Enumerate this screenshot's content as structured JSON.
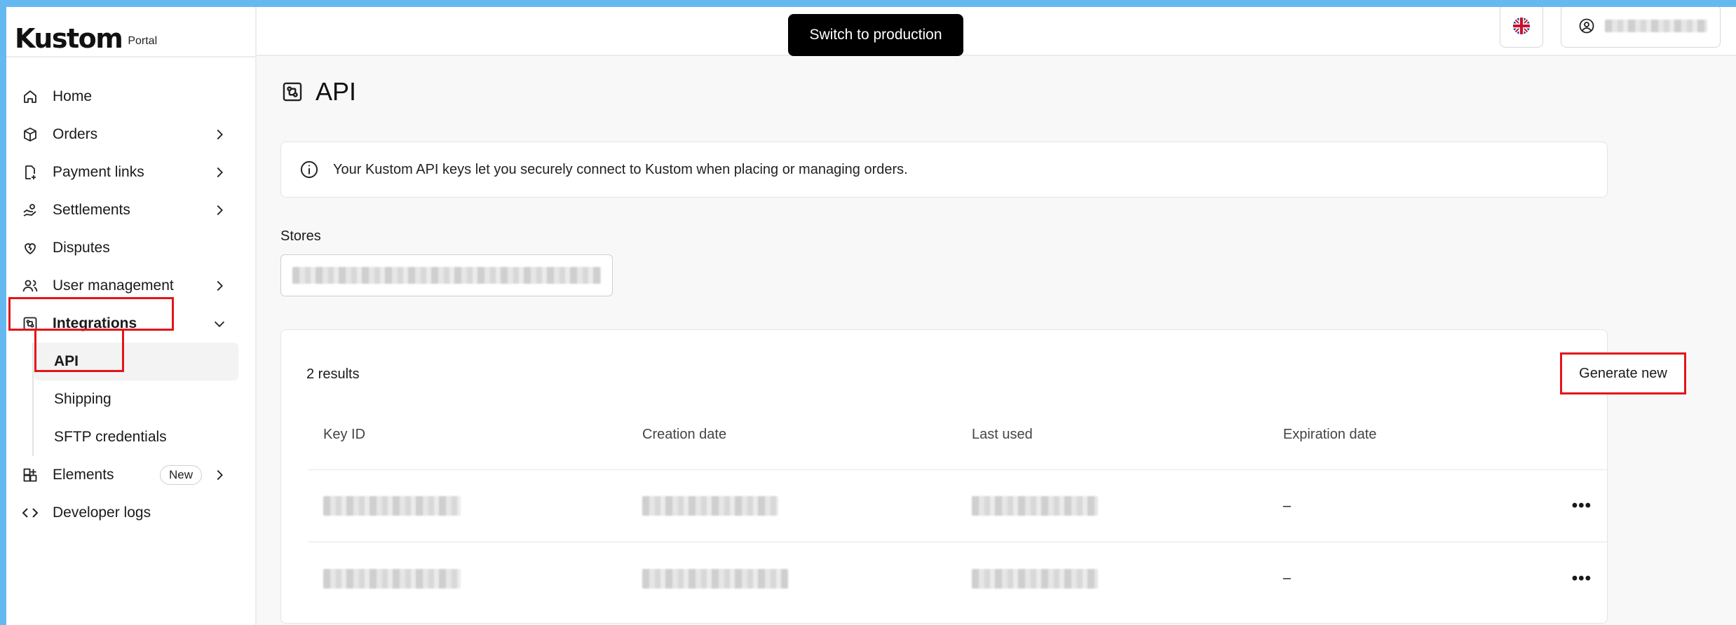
{
  "brand": {
    "logo": "Kustom",
    "suffix": "Portal"
  },
  "sidebar": {
    "items": [
      {
        "label": "Home",
        "icon": "home-icon",
        "chevron": false
      },
      {
        "label": "Orders",
        "icon": "box-icon",
        "chevron": true
      },
      {
        "label": "Payment links",
        "icon": "payment-link-icon",
        "chevron": true
      },
      {
        "label": "Settlements",
        "icon": "hand-coin-icon",
        "chevron": true
      },
      {
        "label": "Disputes",
        "icon": "heart-icon",
        "chevron": false
      },
      {
        "label": "User management",
        "icon": "users-icon",
        "chevron": true
      },
      {
        "label": "Integrations",
        "icon": "integrations-icon",
        "chevron": "down"
      }
    ],
    "subitems": [
      {
        "label": "API",
        "selected": true
      },
      {
        "label": "Shipping",
        "selected": false
      },
      {
        "label": "SFTP credentials",
        "selected": false
      }
    ],
    "elements": {
      "label": "Elements",
      "badge": "New",
      "icon": "grid-plus-icon"
    },
    "devlogs": {
      "label": "Developer logs",
      "icon": "code-icon"
    }
  },
  "topbar": {
    "switch_label": "Switch to production",
    "language_icon": "uk-flag-icon",
    "user_icon": "user-circle-icon"
  },
  "page": {
    "title": "API",
    "info": "Your Kustom API keys let you securely connect to Kustom when placing or managing orders.",
    "stores_label": "Stores"
  },
  "results": {
    "count_label": "2 results",
    "generate_label": "Generate new",
    "columns": [
      "Key ID",
      "Creation date",
      "Last used",
      "Expiration date"
    ],
    "rows": [
      {
        "expiration": "–"
      },
      {
        "expiration": "–"
      }
    ]
  },
  "colors": {
    "highlight": "#e4141b",
    "outer": "#66b9f0"
  }
}
